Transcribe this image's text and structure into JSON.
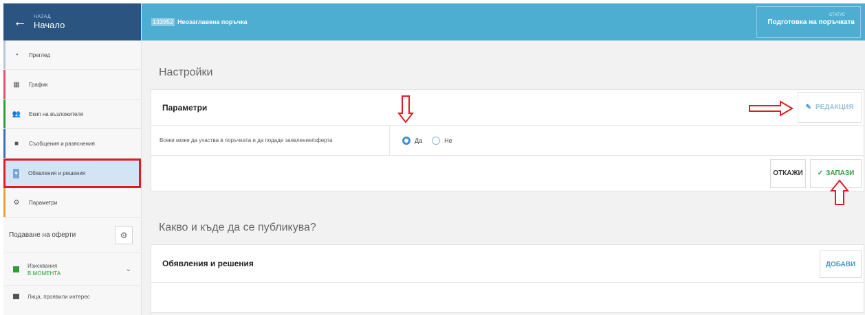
{
  "sidebar": {
    "back_small": "НАЗАД",
    "back_title": "Начало",
    "items": [
      {
        "label": "Преглед",
        "icon": "gauge-icon",
        "accent": ""
      },
      {
        "label": "График",
        "icon": "calendar-icon",
        "accent": "#e0507a"
      },
      {
        "label": "Екип на възложителя",
        "icon": "users-icon",
        "accent": "#2e9d3a"
      },
      {
        "label": "Съобщения и разяснения",
        "icon": "message-icon",
        "accent": "#3f6fb5"
      },
      {
        "label": "Обявления и решения",
        "icon": "pin-icon",
        "accent": "#7aa6d6"
      },
      {
        "label": "Параметри",
        "icon": "gear-icon",
        "accent": "#e8a33c"
      }
    ],
    "group_label": "Подаване на оферти",
    "requirements_label": "Изисквания",
    "requirements_status": "В МОМЕНТА",
    "last_item": "Лица, проявили интерес"
  },
  "topbar": {
    "code": "133952",
    "title": "Неозаглавена поръчка",
    "status_label": "СТАТУС",
    "status_value": "Подготовка на поръчката"
  },
  "settings": {
    "section_title": "Настройки",
    "card_title": "Параметри",
    "edit_label": "РЕДАКЦИЯ",
    "question": "Всеки може да участва в поръчката и да подаде заявление/оферта",
    "option_yes": "Да",
    "option_no": "Не",
    "selected": "Да",
    "cancel_label": "ОТКАЖИ",
    "save_label": "ЗАПАЗИ"
  },
  "publish": {
    "section_title": "Какво и къде да се публикува?",
    "card_title": "Обявления и решения",
    "add_label": "ДОБАВИ"
  },
  "colors": {
    "sidebar_header": "#2b5480",
    "topbar": "#4eaed1",
    "highlight": "#e01b24",
    "save_green": "#2e9d3a"
  }
}
